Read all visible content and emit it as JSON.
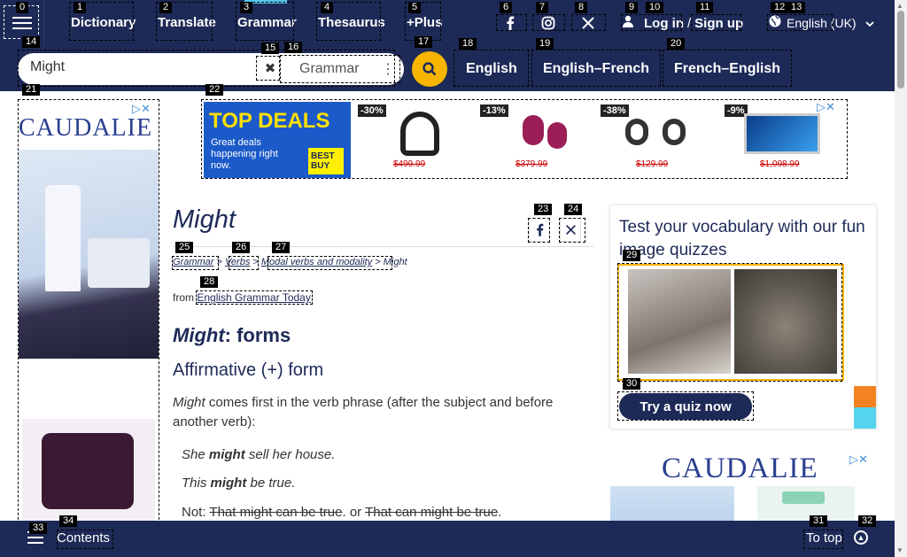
{
  "nav": {
    "dictionary": "Dictionary",
    "translate": "Translate",
    "grammar": "Grammar",
    "thesaurus": "Thesaurus",
    "plus": "+Plus",
    "login": "Log in",
    "slash": "/",
    "signup": "Sign up",
    "language": "English (UK)"
  },
  "search": {
    "value": "Might",
    "dropdown": "Grammar",
    "dict_english": "English",
    "dict_en_fr": "English–French",
    "dict_fr_en": "French–English"
  },
  "ads": {
    "brand": "CAUDALIE",
    "top_deals_title": "TOP DEALS",
    "top_deals_sub": "Great deals happening right now.",
    "best_buy": "BEST BUY",
    "products": [
      {
        "discount": "-30%",
        "price": "$499.99"
      },
      {
        "discount": "-13%",
        "price": "$379.99"
      },
      {
        "discount": "-38%",
        "price": "$129.99"
      },
      {
        "discount": "-9%",
        "price": "$1,098.99"
      }
    ]
  },
  "article": {
    "title": "Might",
    "breadcrumb": [
      "Grammar",
      "Verbs",
      "Modal verbs and modality",
      "Might"
    ],
    "from_label": "from",
    "source": "English Grammar Today",
    "h2_word": "Might",
    "h2_rest": ": forms",
    "h3": "Affirmative (+) form",
    "para_word": "Might",
    "para_rest": " comes first in the verb phrase (after the subject and before another verb):",
    "ex1_a": "She ",
    "ex1_b": "might",
    "ex1_c": " sell her house.",
    "ex2_a": "This ",
    "ex2_b": "might",
    "ex2_c": " be true.",
    "not_label": "Not: ",
    "not_1": "That might can be true",
    "or_label": ". or ",
    "not_2": "That can might be true",
    "end": "."
  },
  "quiz": {
    "title": "Test your vocabulary with our fun image quizzes",
    "button": "Try a quiz now"
  },
  "bottom": {
    "contents": "Contents",
    "to_top": "To top"
  },
  "colors": {
    "navy": "#1d2a57",
    "accent_yellow": "#f7b500",
    "accent_cyan": "#55c7ee"
  }
}
